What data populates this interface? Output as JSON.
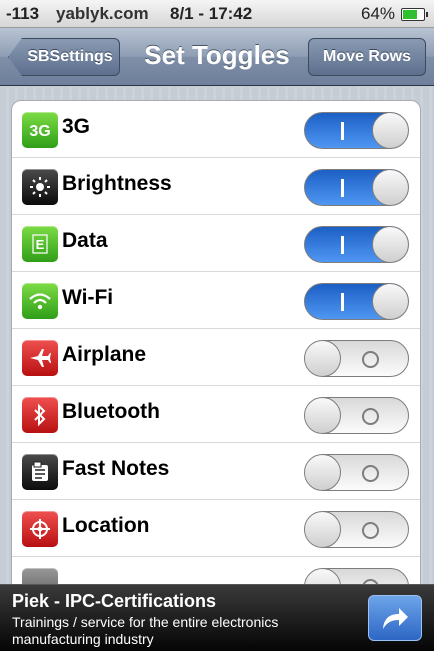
{
  "status_bar": {
    "signal": "-113",
    "carrier": "yablyk.com",
    "time": "8/1 - 17:42",
    "battery_percent": "64%",
    "battery_level": 0.64
  },
  "nav": {
    "back_label": "SBSettings",
    "title": "Set Toggles",
    "right_label": "Move Rows"
  },
  "toggles": [
    {
      "label": "3G",
      "icon": "3g-icon",
      "icon_text": "3G",
      "color": "green",
      "on": true
    },
    {
      "label": "Brightness",
      "icon": "brightness-icon",
      "icon_text": "",
      "color": "black",
      "on": true
    },
    {
      "label": "Data",
      "icon": "data-icon",
      "icon_text": "E",
      "color": "green",
      "on": true
    },
    {
      "label": "Wi-Fi",
      "icon": "wifi-icon",
      "icon_text": "",
      "color": "green",
      "on": true
    },
    {
      "label": "Airplane",
      "icon": "airplane-icon",
      "icon_text": "",
      "color": "red",
      "on": false
    },
    {
      "label": "Bluetooth",
      "icon": "bluetooth-icon",
      "icon_text": "",
      "color": "red",
      "on": false
    },
    {
      "label": "Fast Notes",
      "icon": "notes-icon",
      "icon_text": "",
      "color": "black",
      "on": false
    },
    {
      "label": "Location",
      "icon": "location-icon",
      "icon_text": "",
      "color": "red",
      "on": false
    },
    {
      "label": "",
      "icon": "generic-icon",
      "icon_text": "",
      "color": "grey",
      "on": false
    }
  ],
  "ad": {
    "title": "Piek - IPC-Certifications",
    "body": "Trainings / service for the entire electronics manufacturing industry"
  },
  "colors": {
    "switch_on": "#2f7de1",
    "nav_bar": "#8e9db4",
    "ad_button": "#3f7fd6"
  }
}
